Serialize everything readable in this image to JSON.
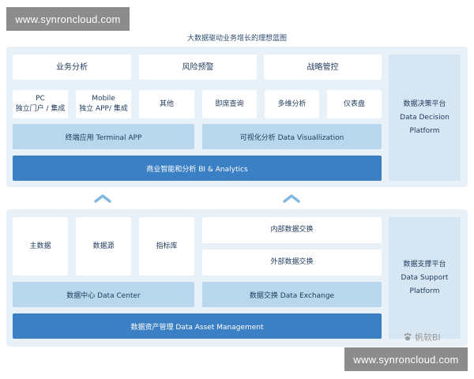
{
  "watermark": {
    "text": "www.synroncloud.com"
  },
  "title": "大数据驱动业务增长的理想蓝图",
  "top": {
    "headers": [
      "业务分析",
      "风险预警",
      "战略管控"
    ],
    "cells": [
      {
        "line1": "PC",
        "line2": "独立门户 / 集成"
      },
      {
        "line1": "Mobile",
        "line2": "独立 APP/ 集成"
      },
      {
        "line1": "其他"
      },
      {
        "line1": "即席查询"
      },
      {
        "line1": "多维分析"
      },
      {
        "line1": "仪表盘"
      }
    ],
    "bars": [
      "终端应用 Terminal APP",
      "可视化分析 Data Visuallization"
    ],
    "main_bar": "商业智能和分析 BI & Analytics",
    "side": {
      "line1": "数据决策平台",
      "line2": "Data Decision",
      "line3": "Platform"
    }
  },
  "bottom": {
    "cells": [
      "主数据",
      "数据源",
      "指标库"
    ],
    "stack": [
      "内部数据交换",
      "外部数据交换"
    ],
    "bars": [
      "数据中心 Data Center",
      "数据交换 Data Exchange"
    ],
    "main_bar": "数据资产管理 Data Asset Management",
    "side": {
      "line1": "数据支撑平台",
      "line2": "Data Support",
      "line3": "Platform"
    }
  },
  "colors": {
    "panel": "#e9f1f8",
    "light_bar": "#b8d7ec",
    "dark_bar": "#3b7fc4",
    "arrow": "#7fb8e0"
  },
  "corner_logo": {
    "text": "帆软BI",
    "icon": "paw-icon"
  }
}
